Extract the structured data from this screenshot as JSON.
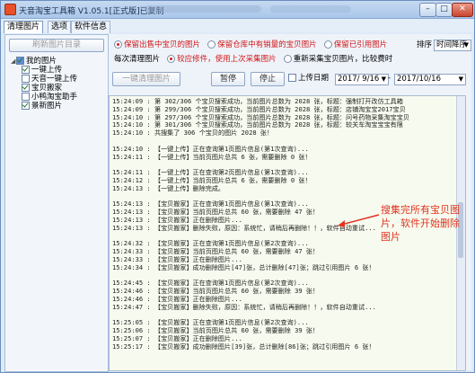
{
  "window": {
    "title": "天音淘宝工具箱 V1.05.1[正式版]已复制"
  },
  "tabs": [
    "清理图片",
    "选项",
    "软件信息"
  ],
  "left_panel": {
    "refresh_button": "刷新图片目录",
    "tree": [
      {
        "label": "我的图片",
        "level": 0,
        "checked": true,
        "root": true
      },
      {
        "label": "一键上传",
        "level": 1,
        "checked": true
      },
      {
        "label": "天音一键上传",
        "level": 1,
        "checked": false
      },
      {
        "label": "宝贝搬家",
        "level": 1,
        "checked": true
      },
      {
        "label": "小鸭淘宝助手",
        "level": 1,
        "checked": false
      },
      {
        "label": "景新图片",
        "level": 1,
        "checked": true
      }
    ]
  },
  "options": {
    "row1": [
      {
        "label": "保留出售中宝贝的图片",
        "selected": true,
        "red": true
      },
      {
        "label": "保留仓库中有销量的宝贝图片",
        "selected": false,
        "red": true
      },
      {
        "label": "保留已引用图片",
        "selected": false,
        "red": true
      }
    ],
    "sort_label": "排序",
    "sort_value": "时间降序",
    "row2_prefix": "每次清理图片",
    "row2": [
      {
        "label": "较应修件，使用上次采集图片",
        "selected": true,
        "red": true
      },
      {
        "label": "重新采集宝贝图片，比较费时",
        "selected": false,
        "red": false
      }
    ]
  },
  "toolbar": {
    "clean_button": "一键清理图片",
    "pause_button": "暂停",
    "stop_button": "停止",
    "upload_date_label": "上传日期",
    "date_from": "2017/ 9/16",
    "date_to": "2017/10/16"
  },
  "log_lines": [
    "15:24:09 : 第 302/306 个宝贝搜索成功，当前图片总数为 2028 张，标题：强制打开改仿工具箱",
    "15:24:09 : 第 299/306 个宝贝搜索成功，当前图片总数为 2028 张，标题：店铺淘宝宝2017宝贝",
    "15:24:10 : 第 297/306 个宝贝搜索成功，当前图片总数为 2028 张，标题：问号药物采集淘宝宝贝",
    "15:24:10 : 第 301/306 个宝贝搜索成功，当前图片总数为 2028 张，标题：较关车淘宝宝宝有限",
    "15:24:10 : 共搜集了 306 个宝贝的图片 2028 张！",
    "",
    "15:24:10 : 【一键上传】正在查询第1页图片信息(第1次查询)...",
    "15:24:11 : 【一键上传】当前页图片总共 6 张，需要删除 0 张！",
    "",
    "15:24:11 : 【一键上传】正在查询第2页图片信息(第1次查询)...",
    "15:24:12 : 【一键上传】当前页图片总共 6 张，需要删除 0 张！",
    "15:24:13 : 【一键上传】删除完成。",
    "",
    "15:24:13 : 【宝贝搬家】正在查询第1页图片信息(第1次查询)...",
    "15:24:13 : 【宝贝搬家】当前页图片总共 60 张，需要删除 47 张！",
    "15:24:13 : 【宝贝搬家】正在删除图片...",
    "15:24:13 : 【宝贝搬家】删除失败，原因：系统忙，请稍后再删除！！，软件自动重试...",
    "",
    "15:24:32 : 【宝贝搬家】正在查询第1页图片信息(第2次查询)...",
    "15:24:33 : 【宝贝搬家】当前页图片总共 60 张，需要删除 47 张！",
    "15:24:33 : 【宝贝搬家】正在删除图片...",
    "15:24:34 : 【宝贝搬家】成功删除图片[47]张，总计删除[47]张；跳过引用图片 6 张！",
    "",
    "15:24:45 : 【宝贝搬家】正在查询第1页图片信息(第2次查询)...",
    "15:24:46 : 【宝贝搬家】当前页图片总共 60 张，需要删除 39 张！",
    "15:24:46 : 【宝贝搬家】正在删除图片...",
    "15:24:47 : 【宝贝搬家】删除失败，原因：系统忙，请稍后再删除！！，软件自动重试...",
    "",
    "15:25:05 : 【宝贝搬家】正在查询第1页图片信息(第2次查询)...",
    "15:25:06 : 【宝贝搬家】当前页图片总共 60 张，需要删除 39 张！",
    "15:25:07 : 【宝贝搬家】正在删除图片...",
    "15:25:17 : 【宝贝搬家】成功删除图片[39]张，总计删除[86]张；跳过引用图片 6 张！"
  ],
  "annotation": "搜集完所有宝贝图片，软件开始删除图片",
  "colors": {
    "accent_red": "#e03420",
    "log_bg": "#f7fbef"
  }
}
